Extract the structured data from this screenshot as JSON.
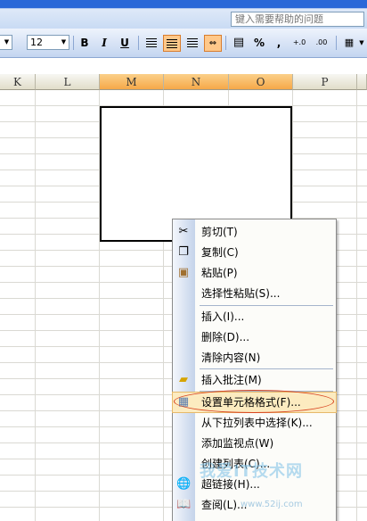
{
  "help": {
    "placeholder": "键入需要帮助的问题"
  },
  "toolbar": {
    "font_size": "12",
    "bold_label": "B",
    "italic_label": "I",
    "underline_label": "U",
    "percent_label": "%",
    "comma_label": ",",
    "increase_decimal_label": "+.0",
    "decrease_decimal_label": ".00"
  },
  "columns": [
    "K",
    "L",
    "M",
    "N",
    "O",
    "P"
  ],
  "selected_columns": [
    "M",
    "N",
    "O"
  ],
  "context_menu": {
    "items": [
      {
        "label": "剪切(T)",
        "icon": "scissors-icon"
      },
      {
        "label": "复制(C)",
        "icon": "copy-icon"
      },
      {
        "label": "粘贴(P)",
        "icon": "paste-icon"
      },
      {
        "label": "选择性粘贴(S)...",
        "icon": ""
      },
      {
        "label": "插入(I)...",
        "icon": ""
      },
      {
        "label": "删除(D)...",
        "icon": ""
      },
      {
        "label": "清除内容(N)",
        "icon": ""
      },
      {
        "label": "插入批注(M)",
        "icon": "comment-icon"
      },
      {
        "label": "设置单元格格式(F)...",
        "icon": "format-cells-icon",
        "highlighted": true
      },
      {
        "label": "从下拉列表中选择(K)...",
        "icon": ""
      },
      {
        "label": "添加监视点(W)",
        "icon": ""
      },
      {
        "label": "创建列表(C)...",
        "icon": ""
      },
      {
        "label": "超链接(H)...",
        "icon": "hyperlink-icon"
      },
      {
        "label": "查阅(L)...",
        "icon": "research-icon"
      }
    ]
  },
  "watermark": {
    "title": "我爱IT技术网",
    "url": "www.52ij.com"
  },
  "colors": {
    "accent_highlight": "#fcebc0",
    "annotation_ellipse": "#d8431f",
    "selected_header": "#f6a848"
  }
}
